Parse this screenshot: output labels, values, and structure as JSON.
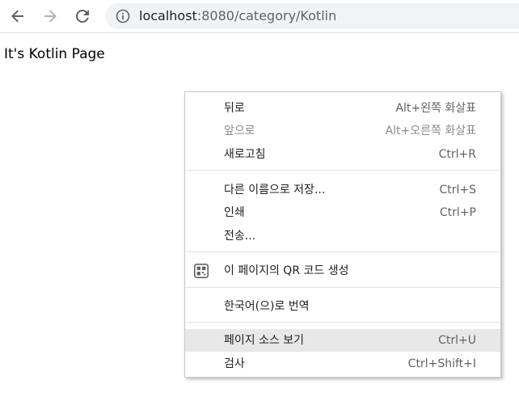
{
  "browser": {
    "url_host": "localhost",
    "url_path": ":8080/category/Kotlin",
    "icons": {
      "back": "back-arrow-icon",
      "forward": "forward-arrow-icon",
      "reload": "reload-icon",
      "site_info": "info-icon"
    }
  },
  "page": {
    "heading": "It's Kotlin Page"
  },
  "context_menu": {
    "back": {
      "label": "뒤로",
      "shortcut": "Alt+왼쪽 화살표"
    },
    "forward": {
      "label": "앞으로",
      "shortcut": "Alt+오른쪽 화살표"
    },
    "reload": {
      "label": "새로고침",
      "shortcut": "Ctrl+R"
    },
    "save_as": {
      "label": "다른 이름으로 저장...",
      "shortcut": "Ctrl+S"
    },
    "print": {
      "label": "인쇄",
      "shortcut": "Ctrl+P"
    },
    "cast": {
      "label": "전송..."
    },
    "qr_code": {
      "label": "이 페이지의 QR 코드 생성",
      "icon": "qr-code-icon"
    },
    "translate": {
      "label": "한국어(으)로 번역"
    },
    "view_source": {
      "label": "페이지 소스 보기",
      "shortcut": "Ctrl+U"
    },
    "inspect": {
      "label": "검사",
      "shortcut": "Ctrl+Shift+I"
    }
  }
}
